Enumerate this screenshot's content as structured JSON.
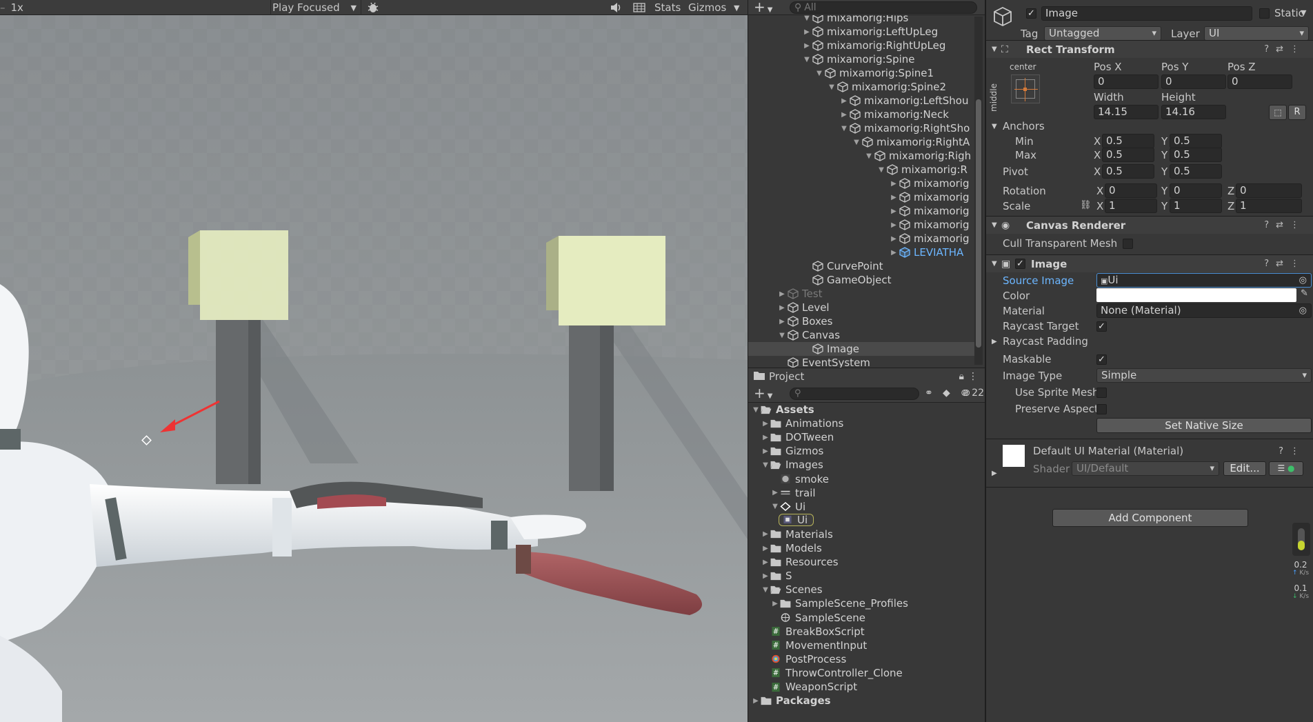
{
  "game": {
    "scale": "1x",
    "play_mode": "Play Focused",
    "stats": "Stats",
    "gizmos": "Gizmos"
  },
  "hierarchy": {
    "search_placeholder": "All",
    "items": [
      {
        "label": "mixamorig:Hips",
        "indent": 0
      },
      {
        "label": "mixamorig:LeftUpLeg",
        "indent": 1
      },
      {
        "label": "mixamorig:RightUpLeg",
        "indent": 1
      },
      {
        "label": "mixamorig:Spine",
        "indent": 1
      },
      {
        "label": "mixamorig:Spine1",
        "indent": 2
      },
      {
        "label": "mixamorig:Spine2",
        "indent": 3
      },
      {
        "label": "mixamorig:LeftShou",
        "indent": 4
      },
      {
        "label": "mixamorig:Neck",
        "indent": 4
      },
      {
        "label": "mixamorig:RightSho",
        "indent": 4
      },
      {
        "label": "mixamorig:RightA",
        "indent": 5
      },
      {
        "label": "mixamorig:Righ",
        "indent": 6
      },
      {
        "label": "mixamorig:R",
        "indent": 7
      },
      {
        "label": "mixamorig",
        "indent": 8
      },
      {
        "label": "mixamorig",
        "indent": 8
      },
      {
        "label": "mixamorig",
        "indent": 8
      },
      {
        "label": "mixamorig",
        "indent": 8
      },
      {
        "label": "mixamorig",
        "indent": 8
      },
      {
        "label": "LEVIATHA",
        "indent": 8
      },
      {
        "label": "CurvePoint",
        "indent": 0
      },
      {
        "label": "GameObject",
        "indent": 0
      },
      {
        "label": "Test",
        "indent": -1
      },
      {
        "label": "Level",
        "indent": -1
      },
      {
        "label": "Boxes",
        "indent": -1
      },
      {
        "label": "Canvas",
        "indent": -1
      },
      {
        "label": "Image",
        "indent": 0
      },
      {
        "label": "EventSystem",
        "indent": -1
      }
    ]
  },
  "project": {
    "tab": "Project",
    "hidden_count": "22",
    "items": [
      {
        "label": "Assets"
      },
      {
        "label": "Animations"
      },
      {
        "label": "DOTween"
      },
      {
        "label": "Gizmos"
      },
      {
        "label": "Images"
      },
      {
        "label": "smoke"
      },
      {
        "label": "trail"
      },
      {
        "label": "Ui"
      },
      {
        "label": "Ui"
      },
      {
        "label": "Materials"
      },
      {
        "label": "Models"
      },
      {
        "label": "Resources"
      },
      {
        "label": "S"
      },
      {
        "label": "Scenes"
      },
      {
        "label": "SampleScene_Profiles"
      },
      {
        "label": "SampleScene"
      },
      {
        "label": "BreakBoxScript"
      },
      {
        "label": "MovementInput"
      },
      {
        "label": "PostProcess"
      },
      {
        "label": "ThrowController_Clone"
      },
      {
        "label": "WeaponScript"
      },
      {
        "label": "Packages"
      }
    ]
  },
  "inspector": {
    "object_name": "Image",
    "static_label": "Static",
    "tag_label": "Tag",
    "tag_value": "Untagged",
    "layer_label": "Layer",
    "layer_value": "UI",
    "rect": {
      "title": "Rect Transform",
      "anchor_h": "center",
      "anchor_v": "middle",
      "pos_x_label": "Pos X",
      "pos_y_label": "Pos Y",
      "pos_z_label": "Pos Z",
      "pos_x": "0",
      "pos_y": "0",
      "pos_z": "0",
      "width_label": "Width",
      "height_label": "Height",
      "width": "14.15",
      "height": "14.16",
      "r_button": "R",
      "anchors_label": "Anchors",
      "min_label": "Min",
      "max_label": "Max",
      "min_x": "0.5",
      "min_y": "0.5",
      "max_x": "0.5",
      "max_y": "0.5",
      "pivot_label": "Pivot",
      "pivot_x": "0.5",
      "pivot_y": "0.5",
      "rotation_label": "Rotation",
      "rot_x": "0",
      "rot_y": "0",
      "rot_z": "0",
      "scale_label": "Scale",
      "scale_x": "1",
      "scale_y": "1",
      "scale_z": "1",
      "x": "X",
      "y": "Y",
      "z": "Z"
    },
    "canvas_renderer": {
      "title": "Canvas Renderer",
      "cull_label": "Cull Transparent Mesh"
    },
    "image": {
      "title": "Image",
      "source_label": "Source Image",
      "source_value": "Ui",
      "color_label": "Color",
      "material_label": "Material",
      "material_value": "None (Material)",
      "raycast_label": "Raycast Target",
      "padding_label": "Raycast Padding",
      "maskable_label": "Maskable",
      "type_label": "Image Type",
      "type_value": "Simple",
      "sprite_mesh_label": "Use Sprite Mesh",
      "aspect_label": "Preserve Aspect",
      "native_btn": "Set Native Size"
    },
    "material": {
      "title": "Default UI Material (Material)",
      "shader_label": "Shader",
      "shader_value": "UI/Default",
      "edit_btn": "Edit..."
    },
    "add_component": "Add Component",
    "net_up": "0.2",
    "net_down": "0.1",
    "net_unit": "K/s"
  },
  "colors": {
    "accent_blue": "#6cb6ff",
    "selection": "#4a4a4a",
    "scene_floor": "#8f9496",
    "cube_face": "#e6eec0",
    "arrow_red": "#ee3333"
  }
}
